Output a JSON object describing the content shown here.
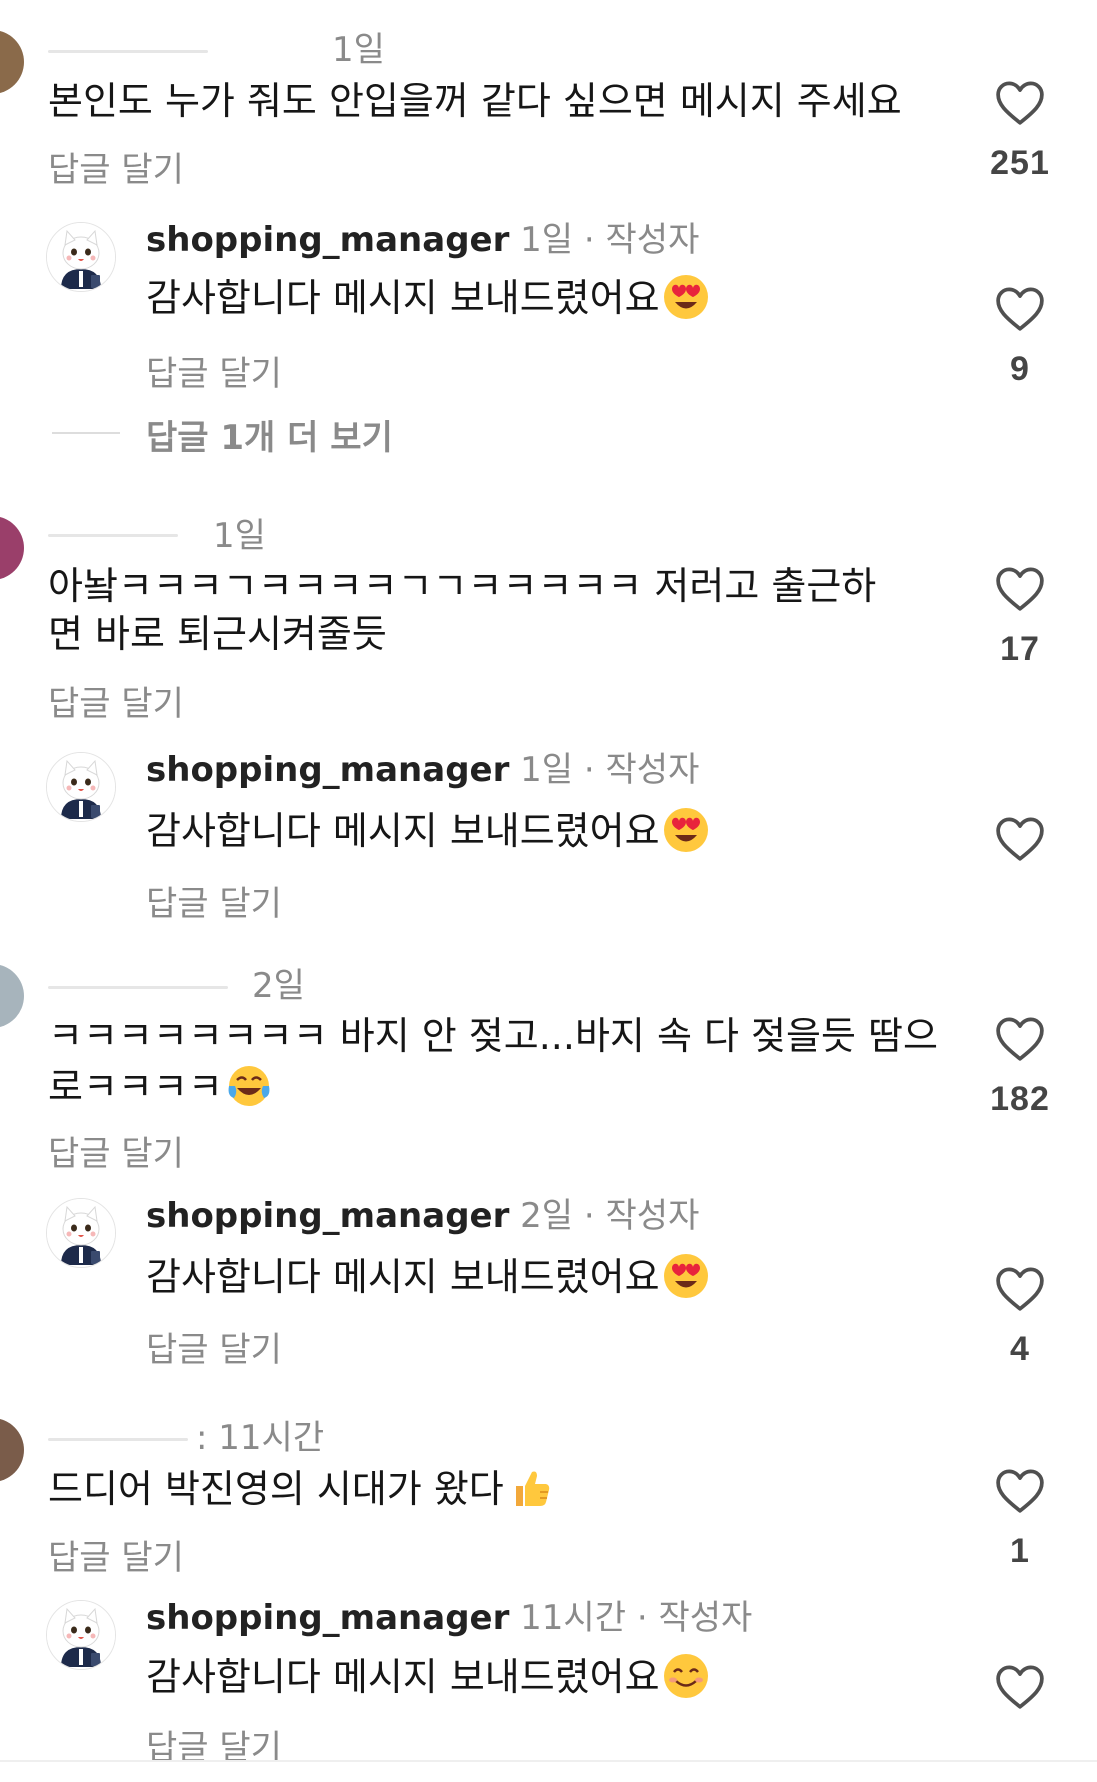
{
  "colors": {
    "text": "#161616",
    "muted": "#8a8a8a",
    "like_icon": "#505050"
  },
  "icons": {
    "like": "heart-outline-icon",
    "heart_eyes": "smiling-face-with-heart-eyes-emoji",
    "tears_of_joy": "face-with-tears-of-joy-emoji",
    "thumbs_up": "thumbs-up-emoji",
    "smiling": "smiling-face-with-smiling-eyes-emoji"
  },
  "comments": [
    {
      "time": "1일",
      "text": "본인도 누가 줘도 안입을꺼 같다 싶으면 메시지 주세요",
      "reply_label": "답글 달기",
      "likes": "251",
      "reply": {
        "username": "shopping_manager",
        "time": "1일",
        "separator": "·",
        "author_tag": "작성자",
        "text": "감사합니다 메시지 보내드렸어요",
        "reply_label": "답글 달기",
        "likes": "9"
      },
      "more_replies_label": "답글 1개 더 보기"
    },
    {
      "time": "1일",
      "text_line1": "아놬ㅋㅋㅋㄱㅋㅋㅋㅋㄱㄱㅋㅋㅋㅋㅋ 저러고 출근하",
      "text_line2": "면 바로 퇴근시켜줄듯",
      "reply_label": "답글 달기",
      "likes": "17",
      "reply": {
        "username": "shopping_manager",
        "time": "1일",
        "separator": "·",
        "author_tag": "작성자",
        "text": "감사합니다 메시지 보내드렸어요",
        "reply_label": "답글 달기",
        "likes": ""
      }
    },
    {
      "time": "2일",
      "text_line1": "ㅋㅋㅋㅋㅋㅋㅋㅋ 바지 안 젖고...바지 속 다 젖을듯 땀으",
      "text_line2": "로ㅋㅋㅋㅋ",
      "reply_label": "답글 달기",
      "likes": "182",
      "reply": {
        "username": "shopping_manager",
        "time": "2일",
        "separator": "·",
        "author_tag": "작성자",
        "text": "감사합니다 메시지 보내드렸어요",
        "reply_label": "답글 달기",
        "likes": "4"
      }
    },
    {
      "time_prefix": ":",
      "time": "11시간",
      "text": "드디어 박진영의 시대가 왔다",
      "reply_label": "답글 달기",
      "likes": "1",
      "reply": {
        "username": "shopping_manager",
        "time": "11시간",
        "separator": "·",
        "author_tag": "작성자",
        "text": "감사합니다 메시지 보내드렸어요",
        "reply_label": "답글 달기",
        "likes": ""
      }
    }
  ]
}
